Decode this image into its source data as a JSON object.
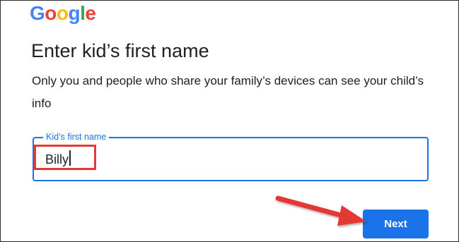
{
  "brand": {
    "logo_letters": [
      {
        "char": "G",
        "color": "#4285F4"
      },
      {
        "char": "o",
        "color": "#EA4335"
      },
      {
        "char": "o",
        "color": "#FBBC05"
      },
      {
        "char": "g",
        "color": "#4285F4"
      },
      {
        "char": "l",
        "color": "#34A853"
      },
      {
        "char": "e",
        "color": "#EA4335"
      }
    ]
  },
  "page": {
    "title": "Enter kid’s first name",
    "subtitle": "Only you and people who share your family’s devices can see your child’s info"
  },
  "name_field": {
    "label": "Kid’s first name",
    "value": "Billy"
  },
  "actions": {
    "next_label": "Next"
  },
  "colors": {
    "accent": "#1a73e8",
    "annotation": "#e53935"
  }
}
